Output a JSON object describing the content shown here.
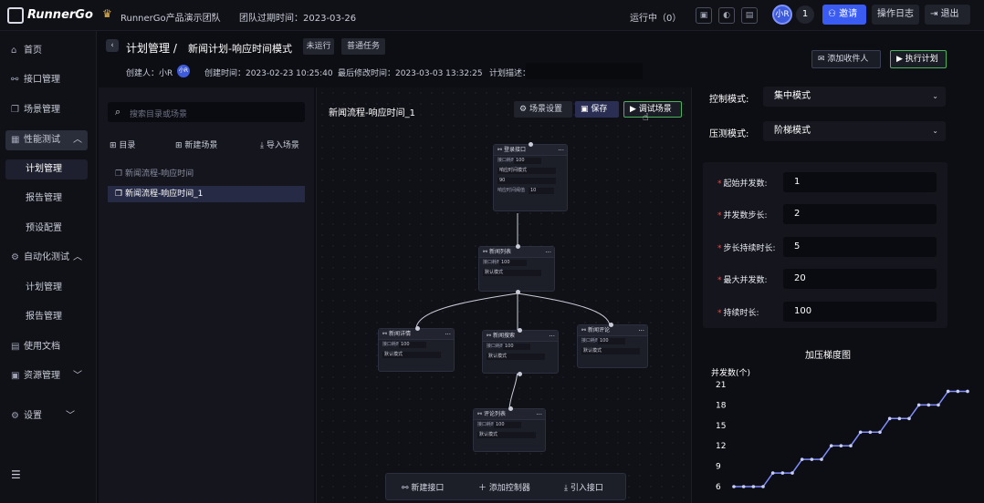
{
  "topbar": {
    "brand": "RunnerGo",
    "team_name": "RunnerGo产品演示团队",
    "expire_label": "团队过期时间：2023-03-26",
    "running_label": "运行中（0）",
    "notify_count": "1",
    "invite_label": "邀请",
    "oplog_label": "操作日志",
    "logout_label": "退出",
    "avatar_text": "小R"
  },
  "sidebar": {
    "items": [
      {
        "label": "首页"
      },
      {
        "label": "接口管理"
      },
      {
        "label": "场景管理"
      },
      {
        "label": "性能测试"
      },
      {
        "label": "计划管理"
      },
      {
        "label": "报告管理"
      },
      {
        "label": "预设配置"
      },
      {
        "label": "自动化测试"
      },
      {
        "label": "计划管理"
      },
      {
        "label": "报告管理"
      },
      {
        "label": "使用文档"
      },
      {
        "label": "资源管理"
      },
      {
        "label": "设置"
      }
    ]
  },
  "header": {
    "crumb_root": "计划管理 /",
    "crumb_current": "新闻计划-响应时间模式",
    "status_tag": "未运行",
    "type_tag": "普通任务",
    "creator_label": "创建人：小R",
    "created_label": "创建时间：2023-02-23 10:25:40",
    "modified_label": "最后修改时间：2023-03-03 13:32:25",
    "desc_label": "计划描述：",
    "add_receiver": "添加收件人",
    "run_plan": "执行计划"
  },
  "leftpanel": {
    "search_placeholder": "搜索目录或场景",
    "tool_dir": "目录",
    "tool_new_scene": "新建场景",
    "tool_import": "导入场景",
    "tree": [
      {
        "label": "新闻流程-响应时间"
      },
      {
        "label": "新闻流程-响应时间_1"
      }
    ]
  },
  "canvas": {
    "scene_title": "新闻流程-响应时间_1",
    "scene_settings": "场景设置",
    "save": "保存",
    "debug": "调试场景",
    "nodes": [
      {
        "title": "登录接口",
        "rows": [
          [
            "接口耗时",
            "100"
          ],
          [
            "响应时间模式",
            ""
          ],
          [
            "90",
            ""
          ],
          [
            "响应时间阈值",
            "10"
          ]
        ]
      },
      {
        "title": "新闻列表",
        "rows": [
          [
            "接口耗时",
            "100"
          ],
          [
            "默认模式",
            ""
          ]
        ]
      },
      {
        "title": "新闻详情",
        "rows": [
          [
            "接口耗时",
            "100"
          ],
          [
            "默认模式",
            ""
          ]
        ]
      },
      {
        "title": "新闻搜索",
        "rows": [
          [
            "接口耗时",
            "100"
          ],
          [
            "默认模式",
            ""
          ]
        ]
      },
      {
        "title": "新闻评论",
        "rows": [
          [
            "接口耗时",
            "100"
          ],
          [
            "默认模式",
            ""
          ]
        ]
      },
      {
        "title": "评论列表",
        "rows": [
          [
            "接口耗时",
            "100"
          ],
          [
            "默认模式",
            ""
          ]
        ]
      }
    ],
    "toolbar_new_api": "新建接口",
    "toolbar_add_controller": "添加控制器",
    "toolbar_import_api": "引入接口"
  },
  "config": {
    "control_mode_label": "控制模式:",
    "control_mode_value": "集中模式",
    "pressure_mode_label": "压测模式:",
    "pressure_mode_value": "阶梯模式",
    "params": [
      {
        "label": "起始并发数:",
        "value": "1"
      },
      {
        "label": "并发数步长:",
        "value": "2"
      },
      {
        "label": "步长持续时长:",
        "value": "5"
      },
      {
        "label": "最大并发数:",
        "value": "20"
      },
      {
        "label": "持续时长:",
        "value": "100"
      }
    ]
  },
  "chart_data": {
    "type": "line",
    "title": "加压梯度图",
    "ylabel": "并发数(个)",
    "y_ticks": [
      "21",
      "18",
      "15",
      "12",
      "9",
      "6"
    ],
    "ylim": [
      6,
      21
    ],
    "series": [
      {
        "values": [
          6,
          6,
          6,
          6,
          8,
          8,
          8,
          10,
          10,
          10,
          12,
          12,
          12,
          14,
          14,
          14,
          16,
          16,
          16,
          18,
          18,
          18,
          20,
          20,
          20
        ]
      }
    ],
    "color": "#7f8cff"
  }
}
